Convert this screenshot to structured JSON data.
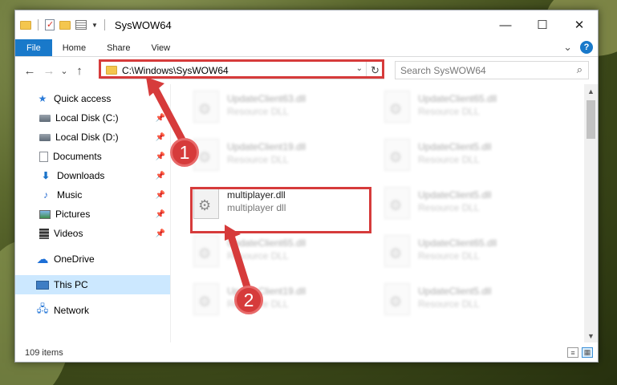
{
  "window": {
    "title": "SysWOW64",
    "controls": {
      "minimize": "—",
      "maximize": "☐",
      "close": "✕"
    }
  },
  "ribbon": {
    "tabs": [
      {
        "label": "File",
        "active": true
      },
      {
        "label": "Home"
      },
      {
        "label": "Share"
      },
      {
        "label": "View"
      }
    ],
    "expand_icon": "⌄",
    "help_label": "?"
  },
  "nav": {
    "back": "←",
    "forward": "→",
    "recent": "⌄",
    "up": "↑"
  },
  "address": {
    "path": "C:\\Windows\\SysWOW64",
    "dropdown": "⌄",
    "refresh": "↻"
  },
  "search": {
    "placeholder": "Search SysWOW64",
    "icon": "⌕"
  },
  "sidebar": {
    "items": [
      {
        "label": "Quick access",
        "icon": "star-icon",
        "level": 0
      },
      {
        "label": "Local Disk (C:)",
        "icon": "drive-icon",
        "level": 1,
        "pinned": true
      },
      {
        "label": "Local Disk (D:)",
        "icon": "drive-icon",
        "level": 1,
        "pinned": true
      },
      {
        "label": "Documents",
        "icon": "documents-icon",
        "level": 1,
        "pinned": true
      },
      {
        "label": "Downloads",
        "icon": "download-icon",
        "level": 1,
        "pinned": true
      },
      {
        "label": "Music",
        "icon": "music-icon",
        "level": 1,
        "pinned": true
      },
      {
        "label": "Pictures",
        "icon": "pictures-icon",
        "level": 1,
        "pinned": true
      },
      {
        "label": "Videos",
        "icon": "videos-icon",
        "level": 1,
        "pinned": true
      },
      {
        "label": "OneDrive",
        "icon": "cloud-icon",
        "level": 0
      },
      {
        "label": "This PC",
        "icon": "computer-icon",
        "level": 0,
        "selected": true
      },
      {
        "label": "Network",
        "icon": "network-icon",
        "level": 0
      }
    ]
  },
  "files": {
    "col1": [
      {
        "name": "UpdateClient63.dll",
        "type": "Resource DLL"
      },
      {
        "name": "UpdateClient19.dll",
        "type": "Resource DLL"
      },
      {
        "name": "multiplayer.dll",
        "type": "multiplayer dll"
      },
      {
        "name": "UpdateClient65.dll",
        "type": "Resource DLL"
      },
      {
        "name": "UpdateClient19.dll",
        "type": "Resource DLL"
      }
    ],
    "col2": [
      {
        "name": "UpdateClient65.dll",
        "type": "Resource DLL"
      },
      {
        "name": "UpdateClient5.dll",
        "type": "Resource DLL"
      },
      {
        "name": "UpdateClient5.dll",
        "type": "Resource DLL"
      },
      {
        "name": "UpdateClient65.dll",
        "type": "Resource DLL"
      },
      {
        "name": "UpdateClient5.dll",
        "type": "Resource DLL"
      }
    ]
  },
  "status": {
    "item_count": "109 items"
  },
  "callouts": {
    "step1": "1",
    "step2": "2",
    "color": "#d63b3b"
  }
}
